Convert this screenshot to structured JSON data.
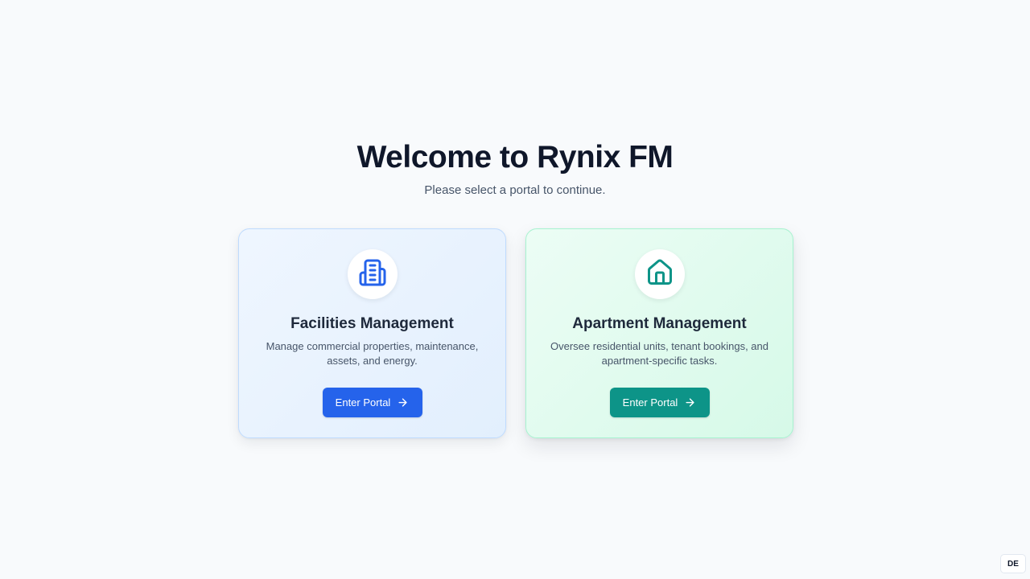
{
  "header": {
    "title": "Welcome to Rynix FM",
    "subtitle": "Please select a portal to continue."
  },
  "portals": [
    {
      "icon": "building-icon",
      "title": "Facilities Management",
      "description": "Manage commercial properties, maintenance, assets, and energy.",
      "button_label": "Enter Portal",
      "accent": "#2563eb"
    },
    {
      "icon": "home-icon",
      "title": "Apartment Management",
      "description": "Oversee residential units, tenant bookings, and apartment-specific tasks.",
      "button_label": "Enter Portal",
      "accent": "#0d9488"
    }
  ],
  "language": {
    "label": "DE"
  }
}
